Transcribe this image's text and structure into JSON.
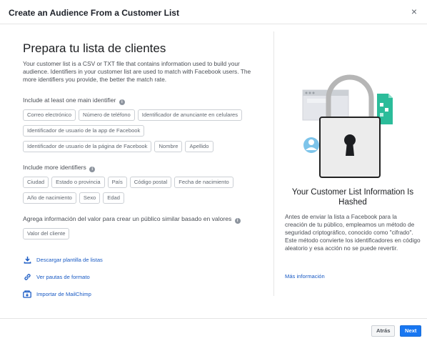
{
  "dialog": {
    "title": "Create an Audience From a Customer List",
    "close_glyph": "×"
  },
  "left": {
    "heading": "Prepara tu lista de clientes",
    "description": "Your customer list is a CSV or TXT file that contains information used to build your audience. Identifiers in your customer list are used to match with Facebook users. The more identifiers you provide, the better the match rate.",
    "main_identifiers": {
      "title": "Include at least one main identifier",
      "chips": [
        "Correo electrónico",
        "Número de teléfono",
        "Identificador de anunciante en celulares",
        "Identificador de usuario de la app de Facebook",
        "Identificador de usuario de la página de Facebook",
        "Nombre",
        "Apellido"
      ]
    },
    "more_identifiers": {
      "title": "Include more identifiers",
      "chips": [
        "Ciudad",
        "Estado o provincia",
        "País",
        "Código postal",
        "Fecha de nacimiento",
        "Año de nacimiento",
        "Sexo",
        "Edad"
      ]
    },
    "value_section": {
      "title": "Agrega información del valor para crear un público similar basado en valores",
      "chips": [
        "Valor del cliente"
      ]
    },
    "links": [
      {
        "label": "Descargar plantilla de listas",
        "icon": "download-icon"
      },
      {
        "label": "Ver pautas de formato",
        "icon": "link-icon"
      },
      {
        "label": "Importar de MailChimp",
        "icon": "import-icon"
      }
    ]
  },
  "right": {
    "headline": "Your Customer List Information Is Hashed",
    "body": "Antes de enviar la lista a Facebook para la creación de tu público, empleamos un método de seguridad criptográfico, conocido como \"cifrado\". Este método convierte los identificadores en código aleatorio y esa acción no se puede revertir.",
    "more_link": "Más información",
    "illustration": "padlock-illustration"
  },
  "footer": {
    "back_label": "Atrás",
    "next_label": "Next"
  },
  "colors": {
    "primary": "#1877f2",
    "link": "#1a5bc4",
    "teal": "#2bbc9a"
  }
}
